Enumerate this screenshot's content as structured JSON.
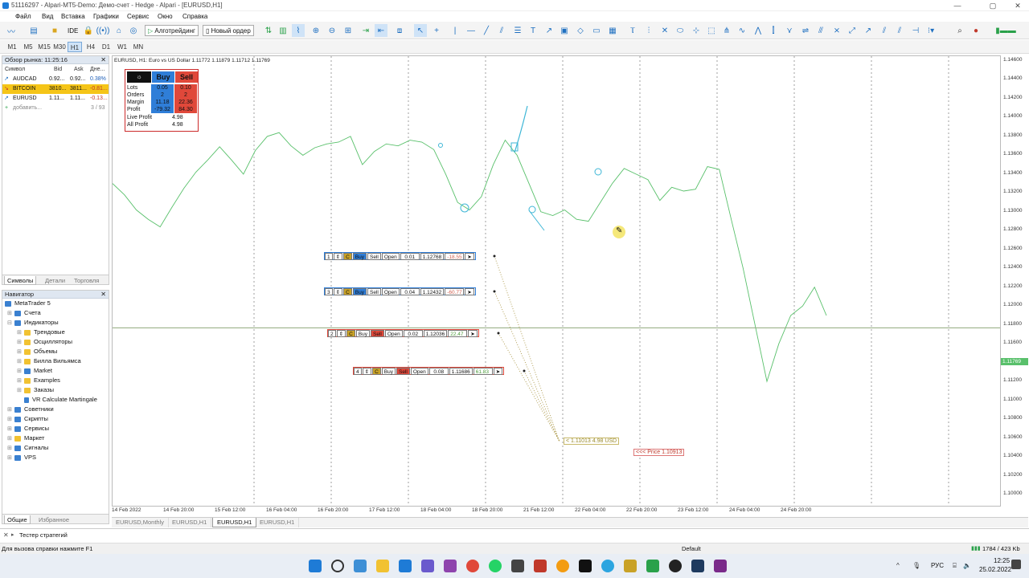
{
  "window": {
    "title": "51116297 - Alpari-MT5-Demo: Демо-счет - Hedge - Alpari - [EURUSD,H1]"
  },
  "menu": [
    "Файл",
    "Вид",
    "Вставка",
    "Графики",
    "Сервис",
    "Окно",
    "Справка"
  ],
  "toolbar": {
    "ide": "IDE",
    "algotrading": "Алготрейдинг",
    "new_order": "Новый ордер"
  },
  "timeframes": [
    "M1",
    "M5",
    "M15",
    "M30",
    "H1",
    "H4",
    "D1",
    "W1",
    "MN"
  ],
  "timeframe_active": "H1",
  "market_watch": {
    "title": "Обзор рынка: 11:25:16",
    "columns": [
      "Символ",
      "Bid",
      "Ask",
      "Дне..."
    ],
    "rows": [
      {
        "symbol": "AUDCAD",
        "bid": "0.92...",
        "ask": "0.92...",
        "chg": "0.38%",
        "chg_color": "#1e5fb8"
      },
      {
        "symbol": "BITCOIN",
        "bid": "3810...",
        "ask": "3811...",
        "chg": "-0.81...",
        "chg_color": "#c0392b"
      },
      {
        "symbol": "EURUSD",
        "bid": "1.11...",
        "ask": "1.11...",
        "chg": "-0.13...",
        "chg_color": "#c0392b"
      }
    ],
    "add_label": "добавить...",
    "count": "3 / 93",
    "tabs": [
      "Символы",
      "Детали",
      "Торговля"
    ]
  },
  "navigator": {
    "title": "Навигатор",
    "items": [
      "MetaTrader 5",
      "Счета",
      "Индикаторы",
      "Трендовые",
      "Осцилляторы",
      "Объемы",
      "Билла Вильямса",
      "Market",
      "Examples",
      "Заказы",
      "VR Calculate Martingale",
      "Советники",
      "Скрипты",
      "Сервисы",
      "Маркет",
      "Сигналы",
      "VPS"
    ],
    "tabs": [
      "Общие",
      "Избранное"
    ]
  },
  "chart": {
    "header": "EURUSD, H1:  Euro vs US Dollar  1.11772 1.11879 1.11712 1.11769",
    "y_labels": [
      "1.14600",
      "1.14400",
      "1.14200",
      "1.14000",
      "1.13800",
      "1.13600",
      "1.13400",
      "1.13200",
      "1.13000",
      "1.12800",
      "1.12600",
      "1.12400",
      "1.12200",
      "1.12000",
      "1.11800",
      "1.11600",
      "1.11400",
      "1.11200",
      "1.11000",
      "1.10800",
      "1.10600",
      "1.10400",
      "1.10200",
      "1.10000"
    ],
    "current_price": "1.11769",
    "x_labels": [
      "14 Feb 2022",
      "14 Feb 20:00",
      "15 Feb 12:00",
      "16 Feb 04:00",
      "16 Feb 20:00",
      "17 Feb 12:00",
      "18 Feb 04:00",
      "18 Feb 20:00",
      "21 Feb 12:00",
      "22 Feb 04:00",
      "22 Feb 20:00",
      "23 Feb 12:00",
      "24 Feb 04:00",
      "24 Feb 20:00"
    ],
    "price_series": [
      1.133,
      1.1318,
      1.1302,
      1.1292,
      1.1284,
      1.1305,
      1.1325,
      1.1342,
      1.1355,
      1.1369,
      1.1355,
      1.134,
      1.1365,
      1.138,
      1.1384,
      1.137,
      1.136,
      1.1368,
      1.1372,
      1.1374,
      1.138,
      1.135,
      1.1364,
      1.1372,
      1.137,
      1.1376,
      1.1374,
      1.1366,
      1.134,
      1.131,
      1.1302,
      1.1316,
      1.135,
      1.1376,
      1.136,
      1.133,
      1.13,
      1.1296,
      1.1302,
      1.1292,
      1.129,
      1.131,
      1.133,
      1.1346,
      1.134,
      1.1334,
      1.1312,
      1.1326,
      1.1322,
      1.1324,
      1.1348,
      1.1345,
      1.1292,
      1.124,
      1.118,
      1.112,
      1.116,
      1.119,
      1.12,
      1.122,
      1.119
    ]
  },
  "trade_panel": {
    "buy": "Buy",
    "sell": "Sell",
    "rows": [
      {
        "label": "Lots",
        "buy": "0.05",
        "sell": "0.10"
      },
      {
        "label": "Orders",
        "buy": "2",
        "sell": "2"
      },
      {
        "label": "Margin",
        "buy": "11.18",
        "sell": "22.36"
      },
      {
        "label": "Profit",
        "buy": "-79.32",
        "sell": "84.30"
      }
    ],
    "live_profit_label": "Live Profit",
    "live_profit": "4.98",
    "all_profit_label": "All Profit",
    "all_profit": "4.98"
  },
  "order_lines": [
    {
      "n": "1",
      "buy": "Buy",
      "sell": "Sell",
      "open": "Open",
      "lots": "0.01",
      "price": "1.12768",
      "pnl": "-18.55",
      "side": "buy"
    },
    {
      "n": "3",
      "buy": "Buy",
      "sell": "Sell",
      "open": "Open",
      "lots": "0.04",
      "price": "1.12432",
      "pnl": "-60.77",
      "side": "buy"
    },
    {
      "n": "2",
      "buy": "Buy",
      "sell": "Sell",
      "open": "Open",
      "lots": "0.02",
      "price": "1.12036",
      "pnl": "22.47",
      "side": "sell"
    },
    {
      "n": "4",
      "buy": "Buy",
      "sell": "Sell",
      "open": "Open",
      "lots": "0.08",
      "price": "1.11686",
      "pnl": "61.83",
      "side": "sell"
    }
  ],
  "target_label": "< 1.11013  4.98 USD",
  "price_label": "<<< Price 1.10913",
  "chart_tabs": [
    "EURUSD,Monthly",
    "EURUSD,H1",
    "EURUSD,H1",
    "EURUSD,H1"
  ],
  "chart_tab_active": 2,
  "tester": "Тестер стратегий",
  "status": {
    "help": "Для вызова справки нажмите F1",
    "profile": "Default",
    "traffic": "1784 / 423 Kb"
  },
  "taskbar": {
    "lang": "РУС",
    "time": "12:25",
    "date": "25.02.2022"
  },
  "colors": {
    "accent": "#1e6fc0",
    "buy": "#2f7ed8",
    "sell": "#e0483a",
    "price_line": "#59c06b",
    "drawing": "#3db6d6"
  }
}
